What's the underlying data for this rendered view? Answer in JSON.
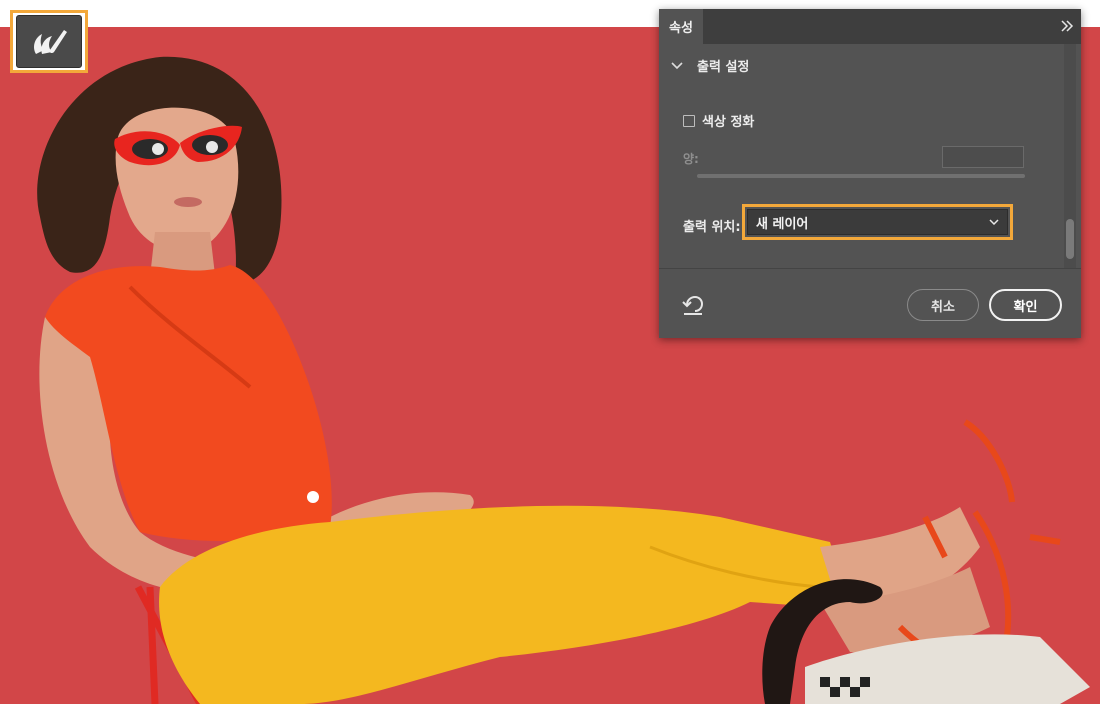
{
  "colors": {
    "canvas_background": "#d24648",
    "highlight": "#f3a83a",
    "panel_background": "#535353",
    "panel_tabbar": "#3e3e3e"
  },
  "tool": {
    "icon": "object-selection-brush-icon"
  },
  "panel": {
    "tab_label": "속성",
    "collapse_icon": "double-chevron-right-icon",
    "section": {
      "title": "출력 설정",
      "expanded": true,
      "icon": "chevron-down-icon"
    },
    "decontaminate": {
      "label": "색상 정화",
      "checked": false
    },
    "amount": {
      "label": "양:",
      "value": ""
    },
    "output": {
      "label": "출력 위치:",
      "value": "새 레이어",
      "icon": "chevron-down-icon"
    },
    "footer": {
      "reset_icon": "reset-icon",
      "cancel_label": "취소",
      "ok_label": "확인"
    }
  }
}
